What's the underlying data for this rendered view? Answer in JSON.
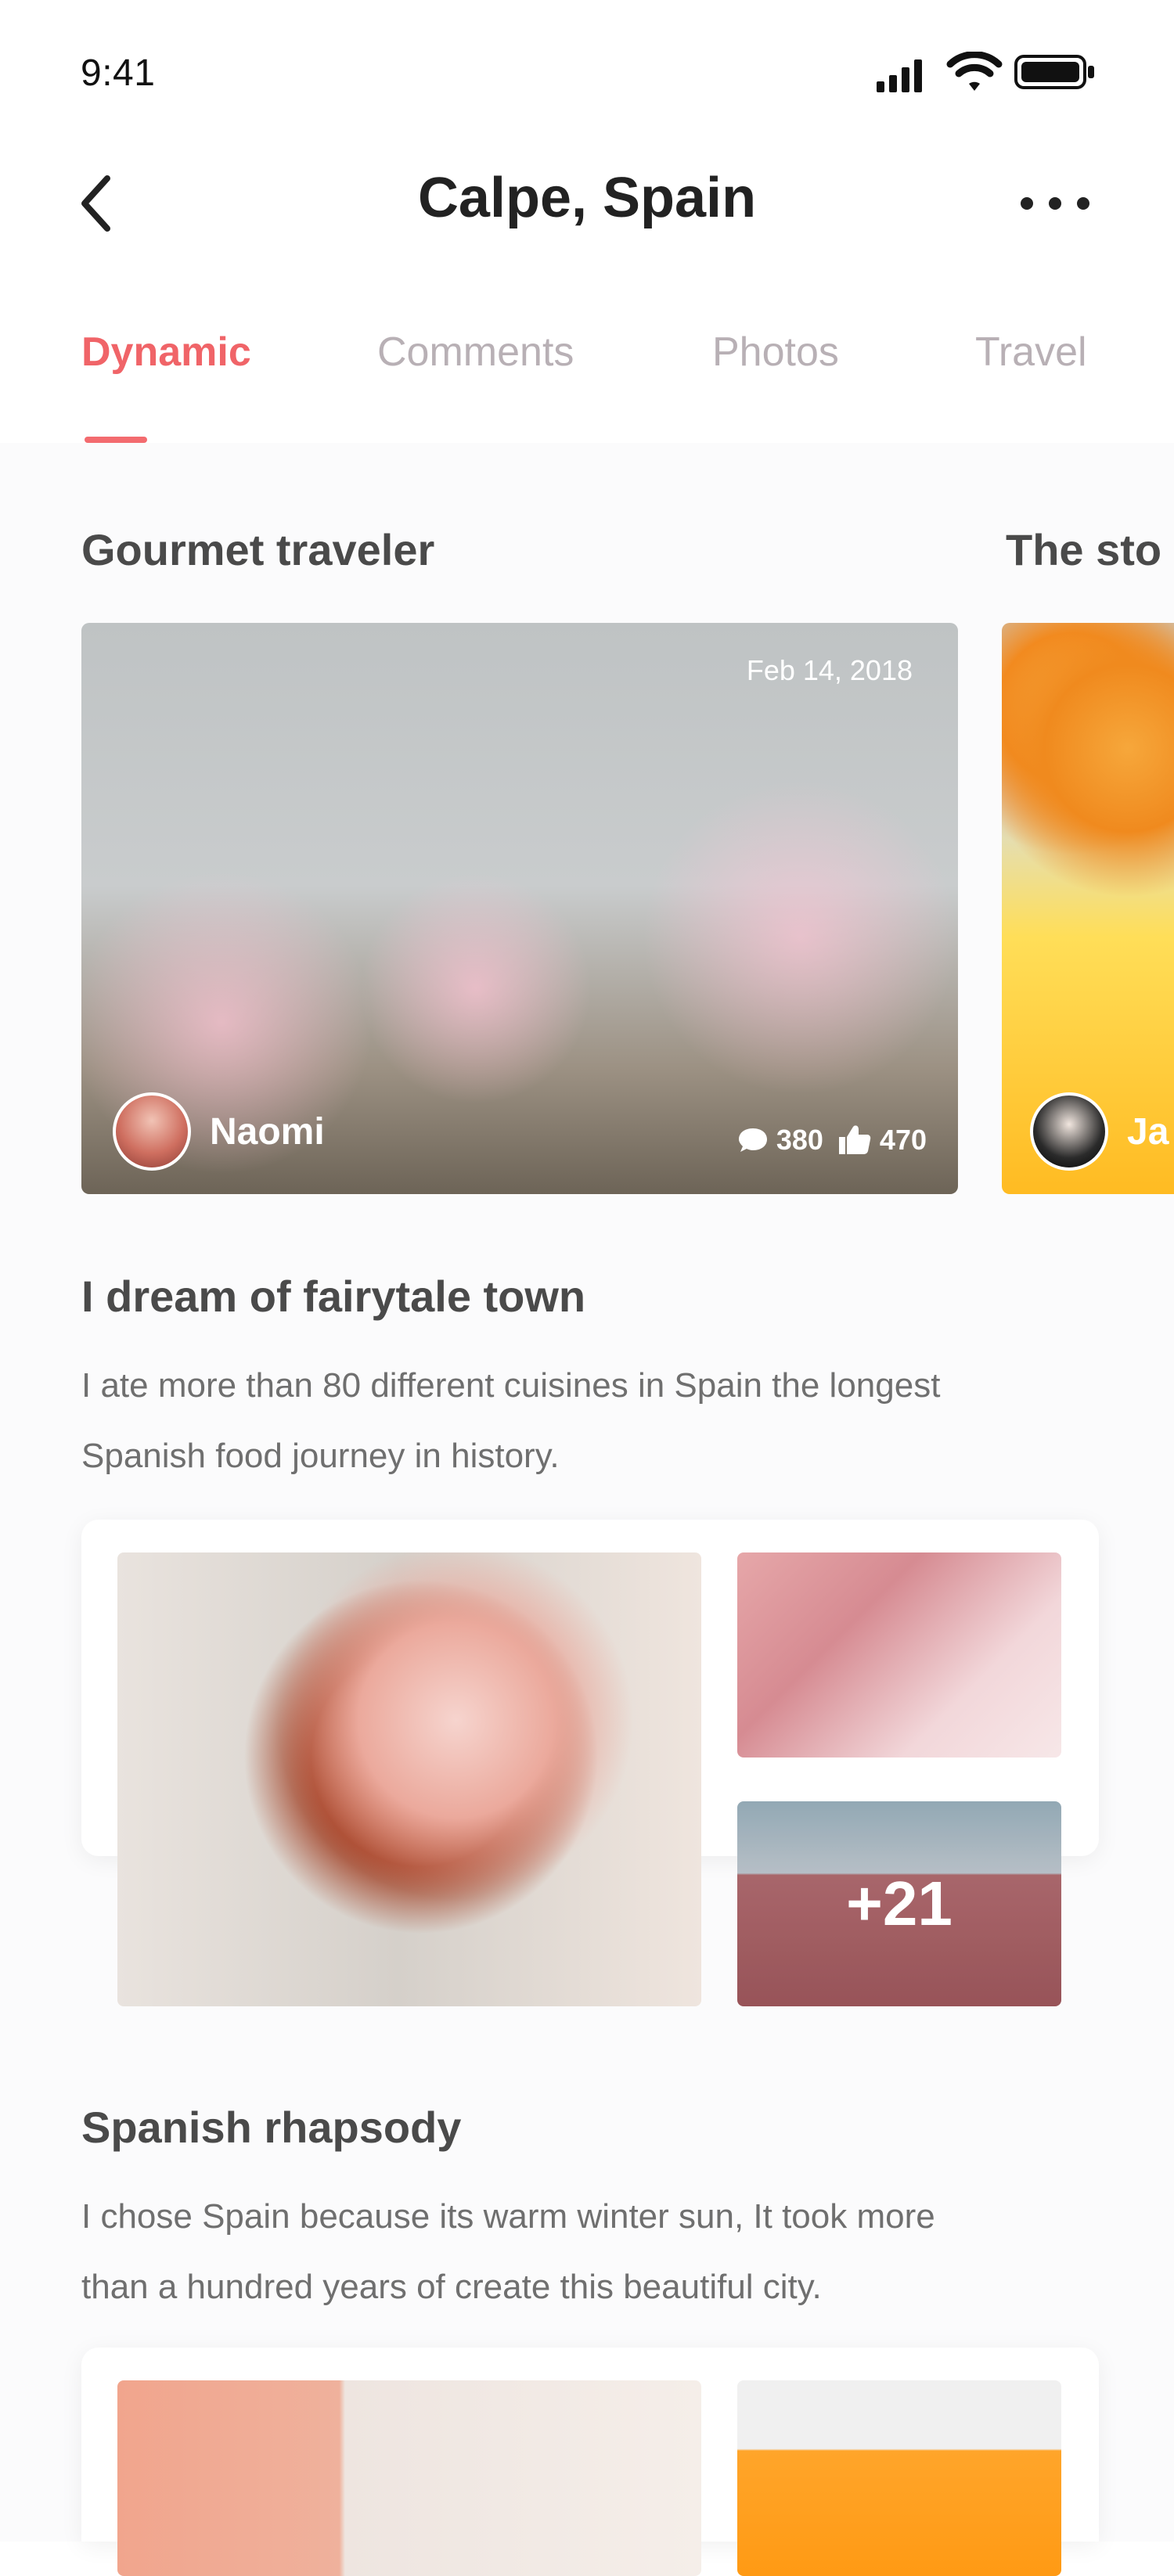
{
  "status": {
    "time": "9:41"
  },
  "nav": {
    "title": "Calpe, Spain",
    "back_icon": "chevron-left-icon",
    "more_icon": "more-horizontal-icon"
  },
  "tabs": [
    {
      "label": "Dynamic",
      "active": true
    },
    {
      "label": "Comments",
      "active": false
    },
    {
      "label": "Photos",
      "active": false
    },
    {
      "label": "Travel",
      "active": false
    }
  ],
  "featured": {
    "sections": [
      {
        "title": "Gourmet traveler"
      },
      {
        "title": "The sto"
      }
    ],
    "cards": [
      {
        "date": "Feb 14, 2018",
        "author": "Naomi",
        "comments": "380",
        "likes": "470",
        "comment_icon": "chat-bubble-icon",
        "like_icon": "thumbs-up-icon"
      },
      {
        "author": "Ja"
      }
    ]
  },
  "posts": [
    {
      "title": "I dream of fairytale town",
      "text_line_1": "I ate more than 80 different cuisines in Spain the longest",
      "text_line_2": "Spanish food journey in history.",
      "more_count": "+21"
    },
    {
      "title": "Spanish rhapsody",
      "text_line_1": "I chose Spain because  its warm winter sun, It took more",
      "text_line_2": "than a hundred years of  create this beautiful city."
    }
  ],
  "colors": {
    "accent": "#f06468",
    "tab_inactive": "#b8b0b5",
    "title": "#222222"
  }
}
